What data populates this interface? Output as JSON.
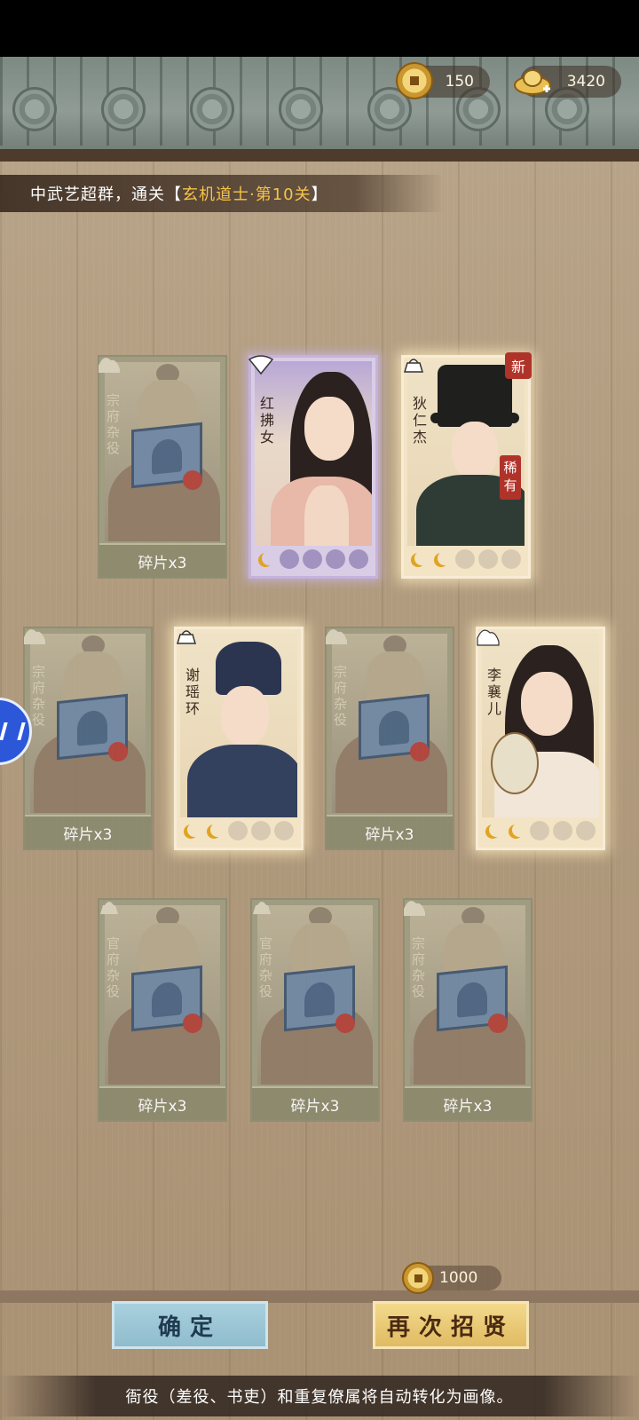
{
  "currency": {
    "coins": "150",
    "ingots": "3420"
  },
  "banner": {
    "prefix": "中武艺超群，通关",
    "bracket_open": "【",
    "stage": "玄机道士·第10关",
    "bracket_close": "】"
  },
  "cards": [
    {
      "kind": "fragment",
      "name": "宗府杂役",
      "footer": "碎片x3"
    },
    {
      "kind": "hero",
      "name": "红拂女",
      "stars_total": 5,
      "stars_filled": 1,
      "frame": "purple"
    },
    {
      "kind": "hero",
      "name": "狄仁杰",
      "stars_total": 5,
      "stars_filled": 2,
      "frame": "gold",
      "new_tag": "新",
      "rarity": "稀有"
    },
    {
      "kind": "fragment",
      "name": "宗府杂役",
      "footer": "碎片x3"
    },
    {
      "kind": "hero",
      "name": "谢瑶环",
      "stars_total": 5,
      "stars_filled": 2,
      "frame": "gold"
    },
    {
      "kind": "fragment",
      "name": "宗府杂役",
      "footer": "碎片x3"
    },
    {
      "kind": "hero",
      "name": "李襄儿",
      "stars_total": 5,
      "stars_filled": 2,
      "frame": "gold"
    },
    {
      "kind": "fragment",
      "name": "官府杂役",
      "footer": "碎片x3"
    },
    {
      "kind": "fragment",
      "name": "官府杂役",
      "footer": "碎片x3"
    },
    {
      "kind": "fragment",
      "name": "宗府杂役",
      "footer": "碎片x3"
    }
  ],
  "recruit_cost": "1000",
  "buttons": {
    "confirm": "确定",
    "recruit_again": "再次招贤"
  },
  "notice": "衙役（差役、书吏）和重复僚属将自动转化为画像。",
  "colors": {
    "gold_text": "#f6c34a",
    "rare_red": "#b0332a",
    "confirm_blue": "#8fbccd",
    "recruit_gold": "#e0bb62"
  }
}
